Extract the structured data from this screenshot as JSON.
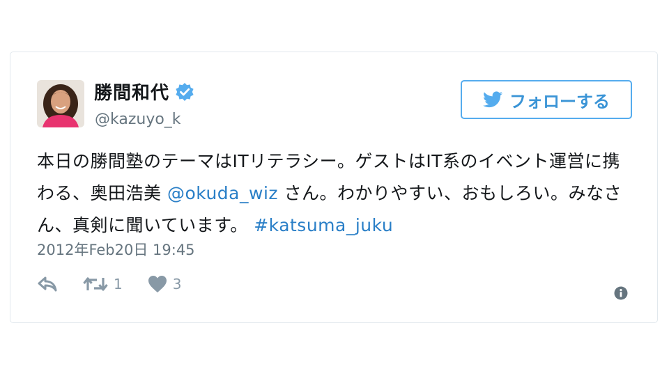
{
  "tweet": {
    "author": {
      "display_name": "勝間和代",
      "handle": "@kazuyo_k",
      "verified": true
    },
    "follow_label": "フォローする",
    "text_parts": [
      {
        "text": "本日の勝間塾のテーマはITリテラシー。ゲストはIT系のイベント運営に携わる、奥田浩美 ",
        "kind": "plain"
      },
      {
        "text": "@okuda_wiz",
        "kind": "mention"
      },
      {
        "text": " さん。わかりやすい、おもしろい。みなさん、真剣に聞いています。 ",
        "kind": "plain"
      },
      {
        "text": "#katsuma_juku",
        "kind": "hashtag"
      }
    ],
    "timestamp": "2012年Feb20日 19:45",
    "retweet_count": "1",
    "like_count": "3"
  },
  "icons": {
    "verified": "verified-badge-icon",
    "follow": "twitter-bird-icon",
    "reply": "reply-icon",
    "retweet": "retweet-icon",
    "like": "heart-icon",
    "info": "info-icon"
  },
  "colors": {
    "accent": "#55acee",
    "link": "#2a7fc7",
    "muted": "#8899a6",
    "border": "#e1e8ed"
  }
}
